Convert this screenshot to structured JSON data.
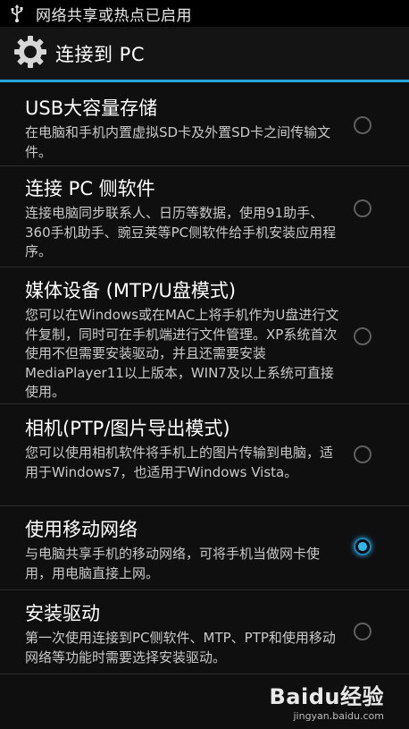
{
  "status_bar": {
    "icon": "usb-icon",
    "text": "网络共享或热点已启用"
  },
  "header": {
    "icon": "gear-icon",
    "title": "连接到 PC",
    "accent_color": "#2aa3d8"
  },
  "options": [
    {
      "title": "USB大容量存储",
      "desc": "在电脑和手机内置虚拟SD卡及外置SD卡之间传输文件。",
      "selected": false
    },
    {
      "title": "连接 PC 侧软件",
      "desc": "连接电脑同步联系人、日历等数据，使用91助手、360手机助手、豌豆荚等PC侧软件给手机安装应用程序。",
      "selected": false
    },
    {
      "title": "媒体设备 (MTP/U盘模式)",
      "desc": "您可以在Windows或在MAC上将手机作为U盘进行文件复制，同时可在手机端进行文件管理。XP系统首次使用不但需要安装驱动，并且还需要安装MediaPlayer11以上版本，WIN7及以上系统可直接使用。",
      "selected": false
    },
    {
      "title": "相机(PTP/图片导出模式)",
      "desc": "您可以使用相机软件将手机上的图片传输到电脑，适用于Windows7，也适用于Windows Vista。",
      "selected": false
    },
    {
      "title": "使用移动网络",
      "desc": "与电脑共享手机的移动网络，可将手机当做网卡使用，用电脑直接上网。",
      "selected": true
    },
    {
      "title": "安装驱动",
      "desc": "第一次使用连接到PC侧软件、MTP、PTP和使用移动网络等功能时需要选择安装驱动。",
      "selected": false
    }
  ],
  "watermark": {
    "logo": "Baidu经验",
    "url": "jingyan.baidu.com"
  }
}
